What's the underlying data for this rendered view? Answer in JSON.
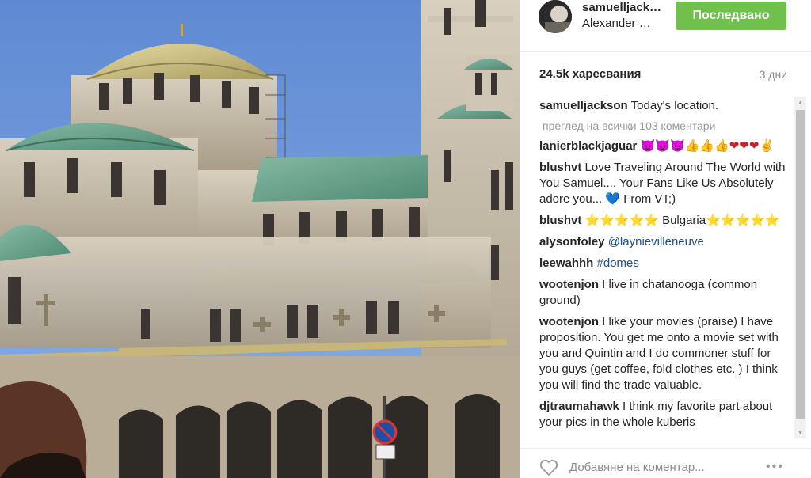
{
  "post": {
    "username": "samuelljack…",
    "location": "Alexander …",
    "follow_label": "Последвано",
    "likes": "24.5k харесвания",
    "timestamp": "3 дни"
  },
  "caption": {
    "author": "samuelljackson",
    "text": "Today's location."
  },
  "view_all_comments": "преглед на всички 103 коментари",
  "comments": [
    {
      "author": "lanierblackjaguar",
      "text": "",
      "emojis": [
        "😈",
        "😈",
        "😈",
        "👍",
        "👍",
        "👍",
        "❤",
        "❤",
        "❤",
        "✌"
      ]
    },
    {
      "author": "blushvt",
      "text": "Love Traveling Around The World with You Samuel.... Your Fans Like Us Absolutely adore you... 💙 From VT;)"
    },
    {
      "author": "blushvt",
      "text": "⭐⭐⭐⭐⭐ Bulgaria⭐⭐⭐⭐⭐"
    },
    {
      "author": "alysonfoley",
      "mention": "@laynievilleneuve"
    },
    {
      "author": "leewahhh",
      "mention": "#domes"
    },
    {
      "author": "wootenjon",
      "text": "I live in chatanooga (common ground)"
    },
    {
      "author": "wootenjon",
      "text": "I like your movies (praise) I have proposition. You get me onto a movie set with you and Quintin and I do commoner stuff for you guys (get coffee, fold clothes etc. ) I think you will find the trade valuable."
    },
    {
      "author": "djtraumahawk",
      "text": "I think my favorite part about your pics in the whole kuberis"
    }
  ],
  "comment_input": {
    "placeholder": "Добавяне на коментар..."
  },
  "icons": {
    "like": "heart-icon",
    "more": "more-options-icon",
    "avatar": "avatar-image"
  },
  "colors": {
    "follow_button": "#6fc14b",
    "mention": "#1f4f88",
    "sky": "#6f95d6",
    "dome": "#5f9e85"
  }
}
